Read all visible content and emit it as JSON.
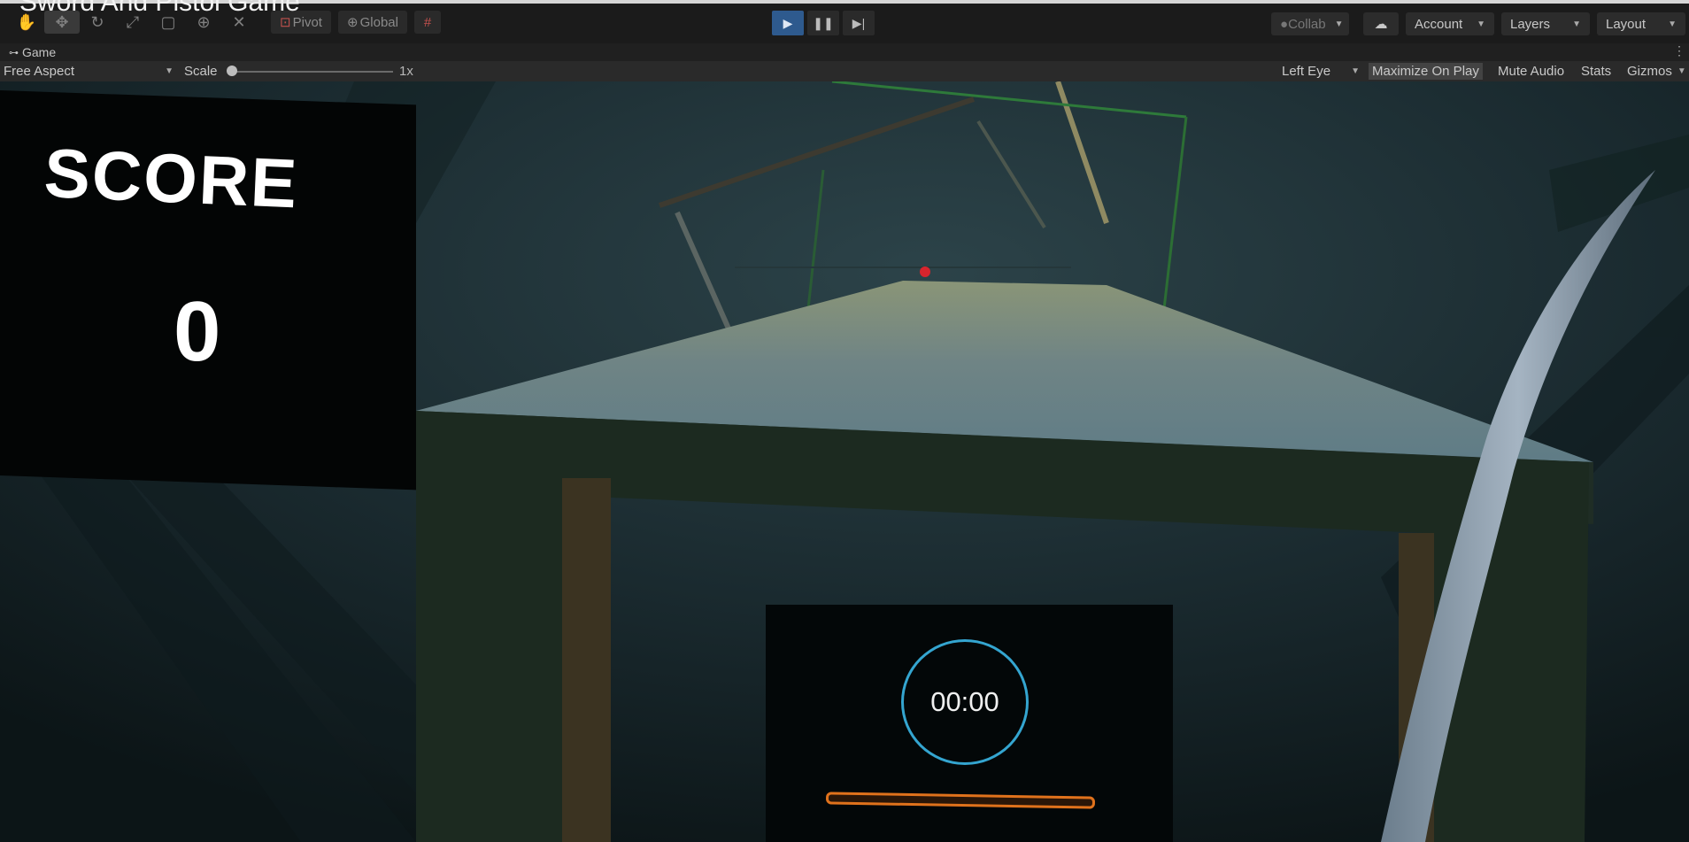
{
  "video_title": "Sword And Pistol Game",
  "toolbar": {
    "tools": [
      "hand-tool-icon",
      "move-tool-icon",
      "rotate-tool-icon",
      "scale-tool-icon",
      "rect-tool-icon",
      "transform-tool-icon",
      "custom-tool-icon"
    ],
    "pivot_label": "Pivot",
    "global_label": "Global",
    "play_controls": [
      "play-icon",
      "pause-icon",
      "step-icon"
    ],
    "collab_label": "Collab",
    "account_label": "Account",
    "layers_label": "Layers",
    "layout_label": "Layout"
  },
  "game_tab": {
    "label": "Game"
  },
  "game_controls": {
    "aspect_value": "Free Aspect",
    "scale_label": "Scale",
    "scale_value": "1x",
    "display_value": "Left Eye",
    "maximize_label": "Maximize On Play",
    "mute_label": "Mute Audio",
    "stats_label": "Stats",
    "gizmos_label": "Gizmos"
  },
  "hud": {
    "score_title": "SCORE",
    "score_value": "0",
    "timer_value": "00:00"
  },
  "colors": {
    "play_active": "#2e5a8e",
    "timer_ring": "#34a5d0",
    "progress_outline": "#e0721c",
    "table_top": "#7f8f7c"
  }
}
